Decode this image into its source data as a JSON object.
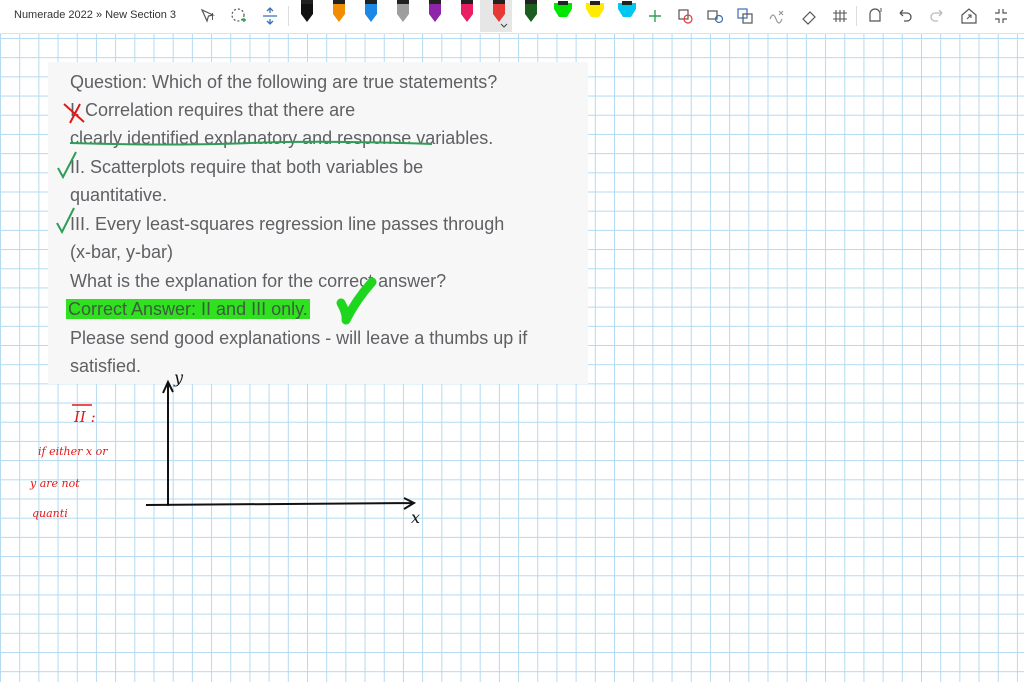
{
  "breadcrumb": "Numerade 2022 » New Section 3",
  "toolbar": {
    "tools": [
      "select-text-icon",
      "lasso-select-icon",
      "add-space-icon"
    ],
    "pens": [
      {
        "name": "pen-black",
        "color": "#111111"
      },
      {
        "name": "pen-orange",
        "color": "#f28c00"
      },
      {
        "name": "pen-blue",
        "color": "#1e88e5"
      },
      {
        "name": "pen-gray",
        "color": "#9e9e9e"
      },
      {
        "name": "pen-purple",
        "color": "#8e24aa"
      },
      {
        "name": "pen-pink",
        "color": "#e91e63"
      },
      {
        "name": "pen-red",
        "color": "#e53935"
      },
      {
        "name": "pen-darkgreen",
        "color": "#1b5e20"
      },
      {
        "name": "highlighter-green",
        "color": "#00e600"
      },
      {
        "name": "highlighter-yellow",
        "color": "#ffeb00"
      },
      {
        "name": "highlighter-cyan",
        "color": "#00c8f0"
      }
    ],
    "actions": [
      "add-pen-icon",
      "ink-to-shape-icon",
      "ink-to-text-icon",
      "lasso-ink-icon",
      "ink-to-math-icon",
      "eraser-icon",
      "ruler-icon",
      "replay-icon",
      "undo-icon",
      "redo-icon",
      "share-icon",
      "full-screen-icon"
    ]
  },
  "question": {
    "lines": [
      "Question: Which of the following are true statements?",
      "I. Correlation requires that there are",
      "clearly identified explanatory and response variables.",
      "II. Scatterplots require that both variables be",
      "quantitative.",
      "III. Every least-squares regression line passes through",
      "(x-bar, y-bar)",
      "What is the explanation for the correct answer?"
    ],
    "correct_answer": "Correct Answer: II and III only.",
    "closing": [
      "Please send good explanations - will leave a thumbs up if",
      "satisfied."
    ]
  },
  "handwriting": {
    "roman_two": "II :",
    "note_line1": "if either x or",
    "note_line2": "y are not",
    "note_line3": "quanti",
    "axis_y": "y",
    "axis_x": "x"
  },
  "colors": {
    "grid": "#b4daf1",
    "green_ink": "#2e9e57",
    "highlight": "#2fe11f",
    "red_ink": "#e01818"
  }
}
